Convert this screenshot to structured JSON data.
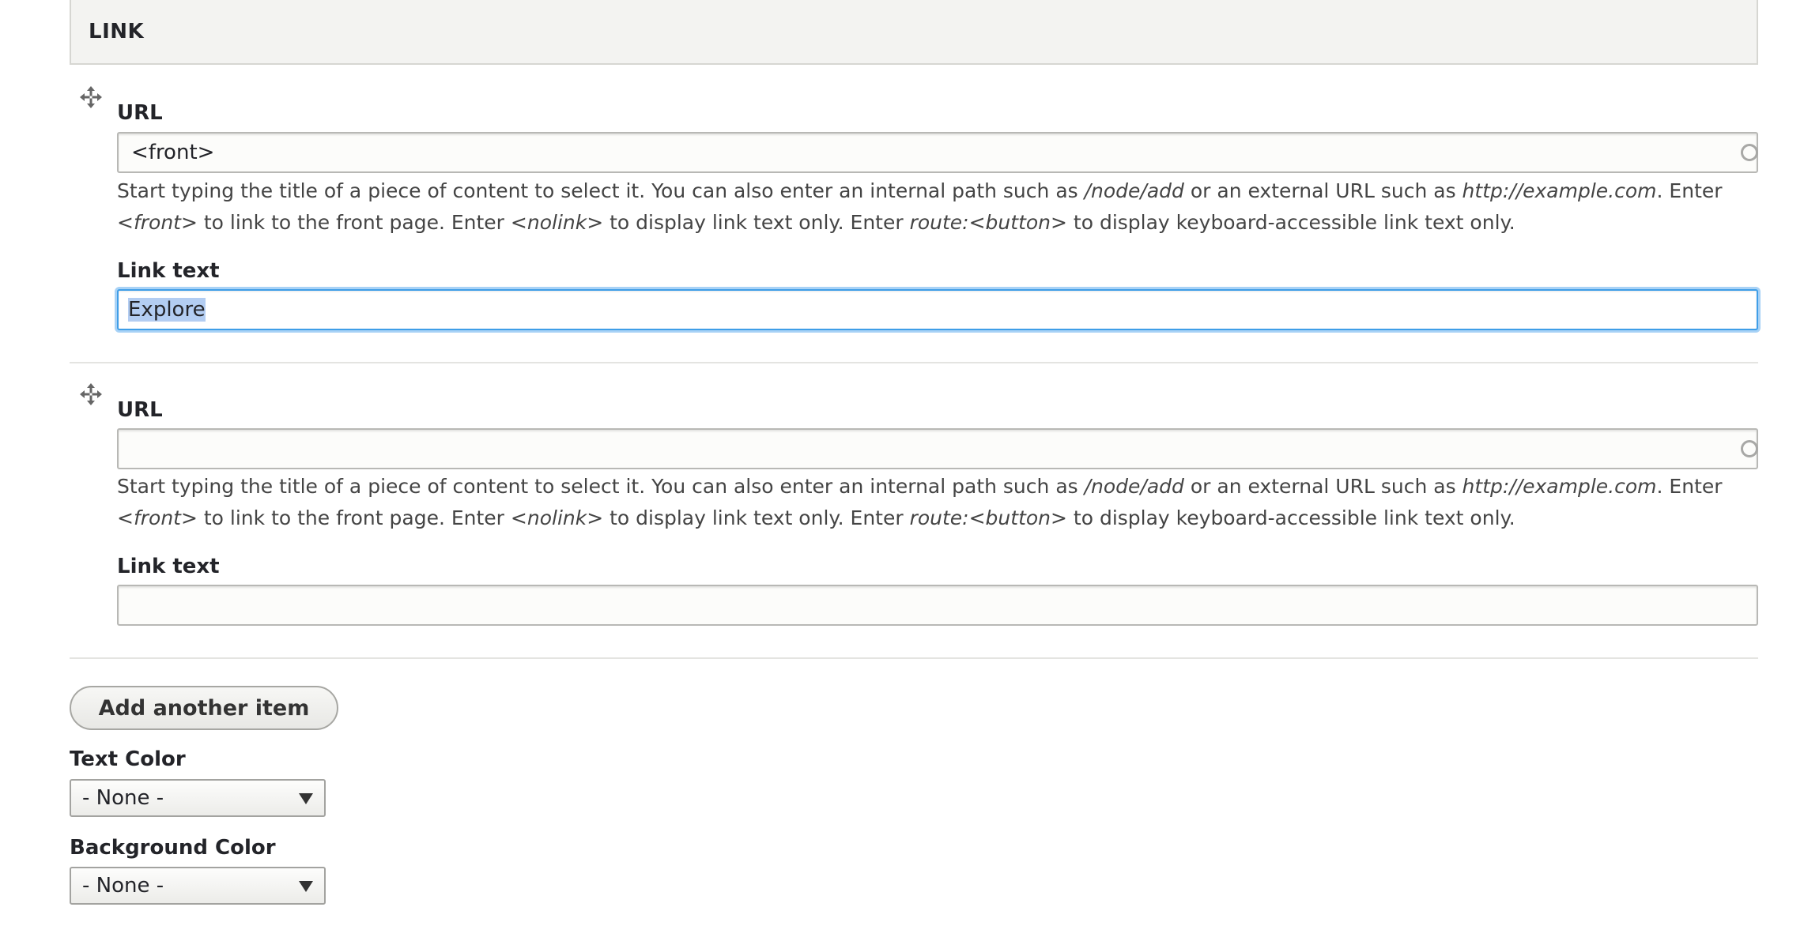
{
  "fieldset": {
    "legend": "LINK"
  },
  "items": [
    {
      "url_label": "URL",
      "url_value": "<front>",
      "description": {
        "p1": "Start typing the title of a piece of content to select it. You can also enter an internal path such as ",
        "e1": "/node/add",
        "p2": " or an external URL such as ",
        "e2": "http://example.com",
        "p3": ". Enter ",
        "e3": "<front>",
        "p4": " to link to the front page. Enter ",
        "e4": "<nolink>",
        "p5": " to display link text only. Enter ",
        "e5": "route:<button>",
        "p6": " to display keyboard-accessible link text only."
      },
      "link_text_label": "Link text",
      "link_text_value": "Explore"
    },
    {
      "url_label": "URL",
      "url_value": "",
      "description": {
        "p1": "Start typing the title of a piece of content to select it. You can also enter an internal path such as ",
        "e1": "/node/add",
        "p2": " or an external URL such as ",
        "e2": "http://example.com",
        "p3": ". Enter ",
        "e3": "<front>",
        "p4": " to link to the front page. Enter ",
        "e4": "<nolink>",
        "p5": " to display link text only. Enter ",
        "e5": "route:<button>",
        "p6": " to display keyboard-accessible link text only."
      },
      "link_text_label": "Link text",
      "link_text_value": ""
    }
  ],
  "add_button_label": "Add another item",
  "text_color": {
    "label": "Text Color",
    "selected": "- None -"
  },
  "background_color": {
    "label": "Background Color",
    "selected": "- None -"
  },
  "colors": {
    "focus_border": "#3f9ee8",
    "selection_highlight": "#b3cdf2",
    "legend_bg": "#f3f3f1"
  },
  "icons": [
    "move-icon",
    "autocomplete-icon",
    "chevron-down-icon"
  ]
}
